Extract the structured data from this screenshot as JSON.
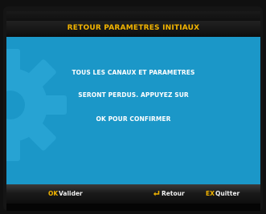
{
  "header": {
    "title": "RETOUR PARAMETRES INITIAUX"
  },
  "dialog": {
    "lines": [
      "TOUS LES CANAUX ET PARAMETRES",
      "SERONT PERDUS. APPUYEZ SUR",
      "OK POUR CONFIRMER"
    ]
  },
  "footer": {
    "ok_key": "OK",
    "ok_label": "Valider",
    "back_label": "Retour",
    "exit_key": "EX",
    "exit_label": "Quitter"
  },
  "colors": {
    "background": "#1b97c8",
    "accent": "#f2b400",
    "text": "#ffffff"
  },
  "icons": [
    "gear-icon",
    "return-arrow-icon"
  ]
}
